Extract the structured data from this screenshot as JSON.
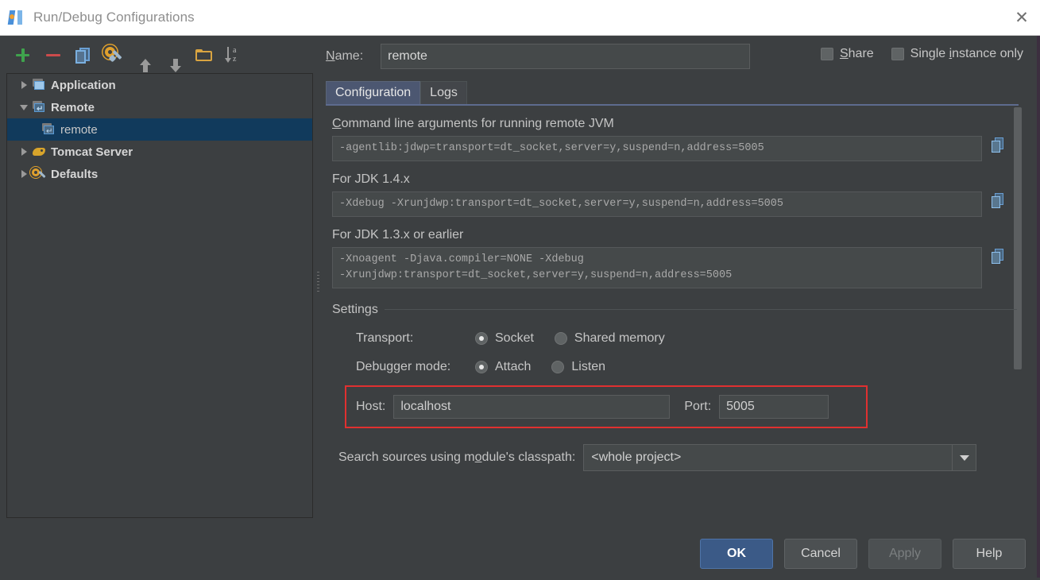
{
  "window": {
    "title": "Run/Debug Configurations",
    "app_icon": "intellij-idea-icon",
    "close_icon": "✕"
  },
  "toolbar": {
    "buttons": [
      {
        "name": "add",
        "icon": "plus-icon",
        "tooltip": "Add New Configuration"
      },
      {
        "name": "remove",
        "icon": "minus-icon",
        "tooltip": "Remove Configuration"
      },
      {
        "name": "copy",
        "icon": "copy-icon",
        "tooltip": "Copy Configuration"
      },
      {
        "name": "edit-defaults",
        "icon": "gear-wrench-icon",
        "tooltip": "Edit defaults"
      },
      {
        "name": "move-up",
        "icon": "arrow-up-icon",
        "tooltip": "Move Up"
      },
      {
        "name": "move-down",
        "icon": "arrow-down-icon",
        "tooltip": "Move Down"
      },
      {
        "name": "new-folder",
        "icon": "folder-icon",
        "tooltip": "Create New Folder"
      },
      {
        "name": "sort",
        "icon": "sort-alphabetical-icon",
        "tooltip": "Sort Configurations"
      }
    ]
  },
  "tree": {
    "items": [
      {
        "label": "Application",
        "icon": "application-icon",
        "state": "collapsed",
        "level": 0,
        "selected": false,
        "bold": true
      },
      {
        "label": "Remote",
        "icon": "remote-icon",
        "state": "expanded",
        "level": 0,
        "selected": false,
        "bold": true
      },
      {
        "label": "remote",
        "icon": "remote-icon",
        "state": "leaf",
        "level": 1,
        "selected": true,
        "bold": false
      },
      {
        "label": "Tomcat Server",
        "icon": "tomcat-icon",
        "state": "collapsed",
        "level": 0,
        "selected": false,
        "bold": true
      },
      {
        "label": "Defaults",
        "icon": "defaults-icon",
        "state": "collapsed",
        "level": 0,
        "selected": false,
        "bold": true
      }
    ]
  },
  "name_row": {
    "label": "Name:",
    "label_mnemonic": "N",
    "value": "remote"
  },
  "options": [
    {
      "label": "Share",
      "mnemonic": "S",
      "checked": false
    },
    {
      "label": "Single instance only",
      "mnemonic": "i",
      "checked": false
    }
  ],
  "tabs": [
    {
      "label": "Configuration",
      "active": true
    },
    {
      "label": "Logs",
      "active": false
    }
  ],
  "sections": {
    "cmdline": {
      "label": "Command line arguments for running remote JVM",
      "label_mnemonic": "C",
      "value": "-agentlib:jdwp=transport=dt_socket,server=y,suspend=n,address=5005",
      "copy_icon": "copy-icon"
    },
    "jdk14": {
      "label": "For JDK 1.4.x",
      "value": "-Xdebug -Xrunjdwp:transport=dt_socket,server=y,suspend=n,address=5005",
      "copy_icon": "copy-icon"
    },
    "jdk13": {
      "label": "For JDK 1.3.x or earlier",
      "value": "-Xnoagent -Djava.compiler=NONE -Xdebug\n-Xrunjdwp:transport=dt_socket,server=y,suspend=n,address=5005",
      "copy_icon": "copy-icon"
    }
  },
  "settings": {
    "group_title": "Settings",
    "transport": {
      "label": "Transport:",
      "options": [
        {
          "label": "Socket",
          "selected": true
        },
        {
          "label": "Shared memory",
          "selected": false
        }
      ]
    },
    "debugger_mode": {
      "label": "Debugger mode:",
      "options": [
        {
          "label": "Attach",
          "selected": true
        },
        {
          "label": "Listen",
          "selected": false
        }
      ]
    },
    "host": {
      "label": "Host:",
      "value": "localhost"
    },
    "port": {
      "label": "Port:",
      "value": "5005"
    },
    "highlight_color": "#e03030"
  },
  "search_sources": {
    "label": "Search sources using module's classpath:",
    "label_mnemonic": "o",
    "selected": "<whole project>"
  },
  "buttons": [
    {
      "label": "OK",
      "style": "default",
      "enabled": true
    },
    {
      "label": "Cancel",
      "style": "normal",
      "enabled": true
    },
    {
      "label": "Apply",
      "style": "normal",
      "enabled": false
    },
    {
      "label": "Help",
      "style": "normal",
      "enabled": true
    }
  ],
  "colors": {
    "background": "#3c3f41",
    "field_background": "#45494a",
    "selection": "#113a5c",
    "tab_active": "#4c5771",
    "accent_button": "#3b5a87",
    "highlight_red": "#e03030"
  }
}
